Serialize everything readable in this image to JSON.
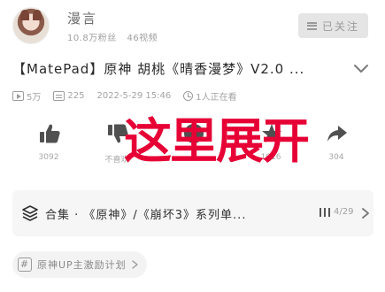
{
  "uploader": {
    "name": "漫言",
    "fans": "10.8万粉丝",
    "videos": "46视频",
    "follow_label": "已关注"
  },
  "video": {
    "title": "【MatePad】原神 胡桃《晴香漫梦》V2.0 ...",
    "views": "5万",
    "danmaku": "225",
    "date": "2022-5-29 15:46",
    "watching": "1人正在看"
  },
  "actions": [
    {
      "name": "like",
      "icon": "thumbs-up-icon",
      "count": "3092"
    },
    {
      "name": "dislike",
      "icon": "thumbs-down-icon",
      "count": "不喜欢"
    },
    {
      "name": "coin",
      "icon": "coin-icon",
      "count": ""
    },
    {
      "name": "favorite",
      "icon": "star-icon",
      "count": "1016"
    },
    {
      "name": "share",
      "icon": "share-icon",
      "count": "304"
    }
  ],
  "overlay": {
    "text": "这里展开",
    "color": "#e60035"
  },
  "collection": {
    "label": "合集 · 《原神》/《崩坏3》系列单...",
    "progress": "4/29"
  },
  "tag": {
    "label": "原神UP主激励计划"
  }
}
